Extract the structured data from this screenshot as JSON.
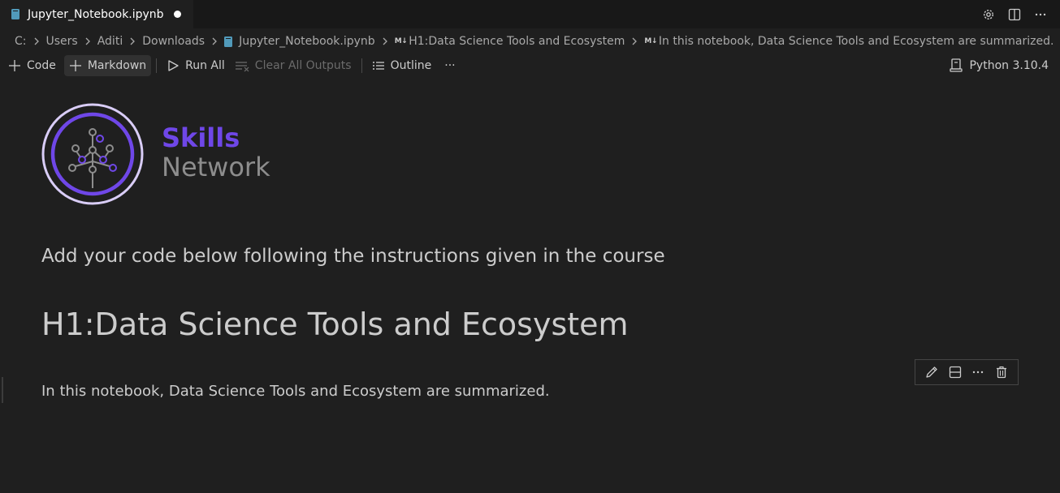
{
  "tab": {
    "title": "Jupyter_Notebook.ipynb",
    "dirty": true
  },
  "tab_actions": [
    "settings-gear-icon",
    "split-editor-icon",
    "more-actions-icon"
  ],
  "breadcrumb": {
    "segments": [
      "C:",
      "Users",
      "Aditi",
      "Downloads",
      "Jupyter_Notebook.ipynb",
      "H1:Data Science Tools and Ecosystem",
      "In this notebook, Data Science Tools and Ecosystem are summarized."
    ],
    "md_badge": "M↓"
  },
  "toolbar": {
    "code_label": "Code",
    "markdown_label": "Markdown",
    "run_all_label": "Run All",
    "clear_outputs_label": "Clear All Outputs",
    "outline_label": "Outline",
    "more_label": "···"
  },
  "kernel": {
    "label": "Python 3.10.4"
  },
  "notebook": {
    "logo": {
      "line1": "Skills",
      "line2": "Network",
      "accent": "#6f47e8"
    },
    "intro": "Add your code below following the instructions given in the course",
    "heading": "H1:Data Science Tools and Ecosystem",
    "summary": "In this notebook, Data Science Tools and Ecosystem are summarized."
  },
  "cell_toolbar": [
    "edit-pencil-icon",
    "split-cell-icon",
    "more-actions-icon",
    "delete-trash-icon"
  ]
}
